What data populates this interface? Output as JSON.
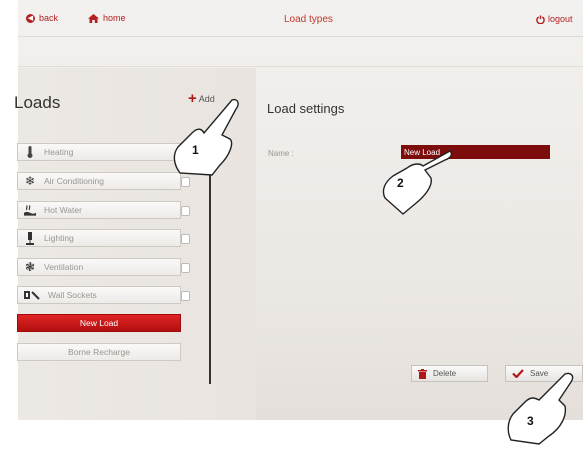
{
  "topbar": {
    "back_label": "back",
    "home_label": "home",
    "title": "Load types",
    "logout_label": "logout"
  },
  "loads_panel": {
    "title": "Loads",
    "add_label": "Add",
    "items": [
      {
        "label": "Heating",
        "icon": "thermometer-icon",
        "locked": false
      },
      {
        "label": "Air Conditioning",
        "icon": "snowflake-icon",
        "locked": true
      },
      {
        "label": "Hot Water",
        "icon": "hot-water-icon",
        "locked": true
      },
      {
        "label": "Lighting",
        "icon": "lamp-icon",
        "locked": true
      },
      {
        "label": "Ventilation",
        "icon": "fan-icon",
        "locked": true
      },
      {
        "label": "Wall Sockets",
        "icon": "plug-icon",
        "locked": true
      },
      {
        "label": "New Load",
        "selected": true
      },
      {
        "label": "Borne Recharge"
      }
    ]
  },
  "settings": {
    "title": "Load settings",
    "name_label": "Name :",
    "name_value": "New Load",
    "delete_label": "Delete",
    "save_label": "Save"
  },
  "callouts": [
    "1",
    "2",
    "3"
  ],
  "colors": {
    "accent": "#b20f0f",
    "input_bg": "#7d0d0d"
  }
}
